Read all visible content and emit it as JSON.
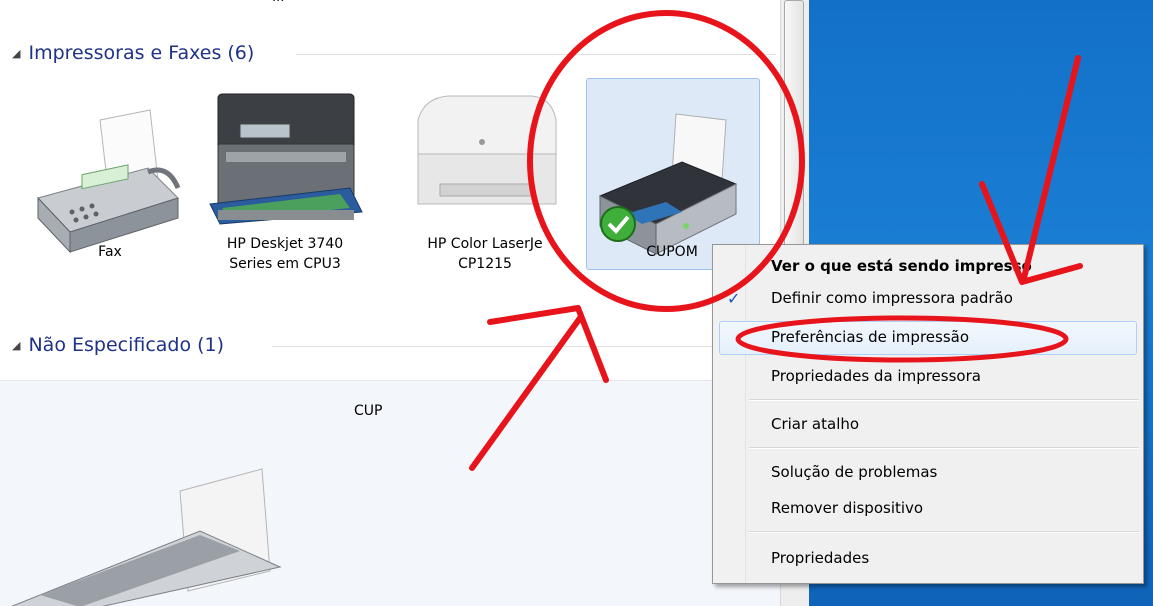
{
  "explorer": {
    "partial_top_text": "···",
    "groups": [
      {
        "label": "Impressoras e Faxes (6)"
      },
      {
        "label": "Não Especificado (1)"
      }
    ],
    "devices": [
      {
        "label": "Fax",
        "icon": "fax-icon"
      },
      {
        "label": "HP Deskjet 3740\nSeries em CPU3",
        "icon": "inkjet-printer-icon"
      },
      {
        "label": "HP Color LaserJe\nCP1215",
        "icon": "laser-printer-icon"
      },
      {
        "label": "CUPOM",
        "icon": "default-printer-icon",
        "selected": true,
        "default": true
      }
    ],
    "preview_label": "CUP"
  },
  "context_menu": {
    "items": [
      {
        "label": "Ver o que está sendo impresso",
        "bold": true
      },
      {
        "label": "Definir como impressora padrão",
        "checked": true
      },
      {
        "label": "Preferências de impressão",
        "highlighted": true
      },
      {
        "label": "Propriedades da impressora"
      },
      {
        "label": "Criar atalho"
      },
      {
        "label": "Solução de problemas"
      },
      {
        "label": "Remover dispositivo"
      },
      {
        "label": "Propriedades"
      }
    ],
    "check_glyph": "✓"
  },
  "annotation_color": "#e8141b",
  "colors": {
    "group_header": "#1e3287",
    "desktop": "#1a7fd4",
    "selection": "#dde9f7"
  }
}
